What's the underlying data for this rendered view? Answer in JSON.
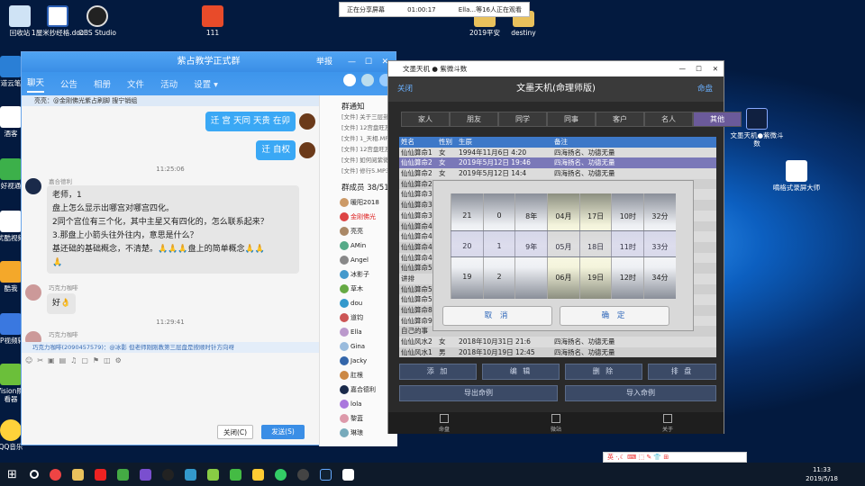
{
  "share_bar": {
    "status": "正在分享屏幕",
    "time": "01:00:17",
    "viewers": "Ella...等16人正在观看"
  },
  "desktop": {
    "icons": [
      "回收站",
      "1屋米抄经格.doc",
      "OBS Studio",
      "111",
      "2019平安",
      "destiny",
      "文墨天机●紫微斗数",
      "嘀格式录屏大师"
    ],
    "left_icons": [
      "有道云笔记",
      "酒客",
      "好视通",
      "优酷视频",
      "酷我",
      "3GP视频转换",
      "3D Vision照片查看器",
      "QQ音乐"
    ]
  },
  "qq": {
    "title": "紫占教学正式群",
    "title_ctl": "举报",
    "tabs": [
      "聊天",
      "公告",
      "相册",
      "文件",
      "活动",
      "设置 ▾"
    ],
    "pinned": "亮亮：@金刚佛光紫占刷脚 搜宁销组",
    "messages": {
      "me1": "迁 宫 天同 天贵 在卯",
      "me2": "迁 自权",
      "time1": "11:25:06",
      "sender1": "嘉合德利",
      "lines": [
        "老师，1",
        "盘上怎么显示出哪宫对哪宫四化。",
        "2同个宫位有三个化，其中主星又有四化的，怎么联系起来？",
        "3.那盘上小箭头往外往内，意思是什么？",
        "基还础的基础概念，不清楚。🙏🙏🙏盘上的简单概念🙏🙏",
        "🙏"
      ],
      "sender2": "巧克力咖啡",
      "ok": "好👌",
      "time2": "11:29:41",
      "sender3": "巧克力咖啡"
    },
    "reply": "巧克力咖啡(2090457579)：@冰影 但老师刚刚教第三层盘是按顺时针方向呀",
    "close_btn": "关闭(C)",
    "send_btn": "发送(S)",
    "notice_title": "群通知",
    "notices": [
      "[文件] 关于三层卦象问...",
      "[文件] 12宫盘旺及问...",
      "[文件] 1_天相.MP3.mp3",
      "[文件] 12宫盘旺及问...",
      "[文件] 如何阅紫微斗数...",
      "[文件] 修行5.MP3"
    ],
    "members_title": "群成员 38/51",
    "members": [
      "暖阳2018",
      "金刚佛光",
      "亮亮",
      "AMin",
      "Angel",
      "冰影子",
      "草木",
      "dou",
      "道钧",
      "Ella",
      "Gina",
      "Jacky",
      "肛根",
      "嘉合德利",
      "lola",
      "黎蓝",
      "琳琅"
    ]
  },
  "app": {
    "window_title": "文墨天机 ● 紫微斗数",
    "back": "关闭",
    "title": "文墨天机(命理师版)",
    "menu": "命盘",
    "tabs": [
      "家人",
      "朋友",
      "同学",
      "同事",
      "客户",
      "名人",
      "其他"
    ],
    "active_tab": "其他",
    "headers": [
      "姓名",
      "性别",
      "生辰",
      "备注"
    ],
    "rows": [
      [
        "仙仙算命1",
        "女",
        "1994年11月6日 4:20",
        "四海扬名、功德无量"
      ],
      [
        "仙仙算命2",
        "女",
        "2019年5月12日 19:46",
        "四海扬名、功德无量"
      ],
      [
        "仙仙算命2",
        "女",
        "2019年5月12日 14:4",
        "四海扬名、功德无量"
      ],
      [
        "仙仙算命2",
        "",
        "",
        ""
      ],
      [
        "仙仙算命3",
        "",
        "",
        ""
      ],
      [
        "仙仙算命3",
        "",
        "",
        ""
      ],
      [
        "仙仙算命3",
        "",
        "",
        ""
      ],
      [
        "仙仙算命4",
        "",
        "",
        ""
      ],
      [
        "仙仙算命4",
        "",
        "",
        ""
      ],
      [
        "仙仙算命4",
        "",
        "",
        ""
      ],
      [
        "仙仙算命4",
        "",
        "",
        ""
      ],
      [
        "仙仙算命5",
        "",
        "",
        ""
      ],
      [
        "讲排",
        "",
        "",
        ""
      ],
      [
        "仙仙算命5",
        "",
        "",
        ""
      ],
      [
        "仙仙算命5",
        "",
        "",
        ""
      ],
      [
        "仙仙算命8",
        "",
        "",
        ""
      ],
      [
        "仙仙算命9",
        "",
        "",
        ""
      ],
      [
        "自己的事",
        "",
        "",
        ""
      ],
      [
        "仙仙风水2",
        "女",
        "2018年10月31日 21:6",
        "四海扬名、功德无量"
      ],
      [
        "仙仙风水1",
        "男",
        "2018年10月19日 12:45",
        "四海扬名、功德无量"
      ]
    ],
    "buttons": [
      "添 加",
      "编 辑",
      "删 除",
      "排 盘",
      "导出命例",
      "导入命例"
    ],
    "footer": [
      "命盘",
      "微站",
      "关于"
    ]
  },
  "picker": {
    "columns": [
      [
        "21",
        "20",
        "19"
      ],
      [
        "0",
        "1",
        "2"
      ],
      [
        "8年",
        "9年",
        ""
      ],
      [
        "04月",
        "05月",
        "06月"
      ],
      [
        "17日",
        "18日",
        "19日"
      ],
      [
        "10时",
        "11时",
        "12时"
      ],
      [
        "32分",
        "33分",
        "34分"
      ]
    ],
    "cancel": "取 消",
    "ok": "确 定"
  },
  "ime": "英 ·,☾ ⌨ ⬚ ✎ 👕 ⊞",
  "clock": {
    "time": "11:33",
    "date": "2019/5/18"
  }
}
